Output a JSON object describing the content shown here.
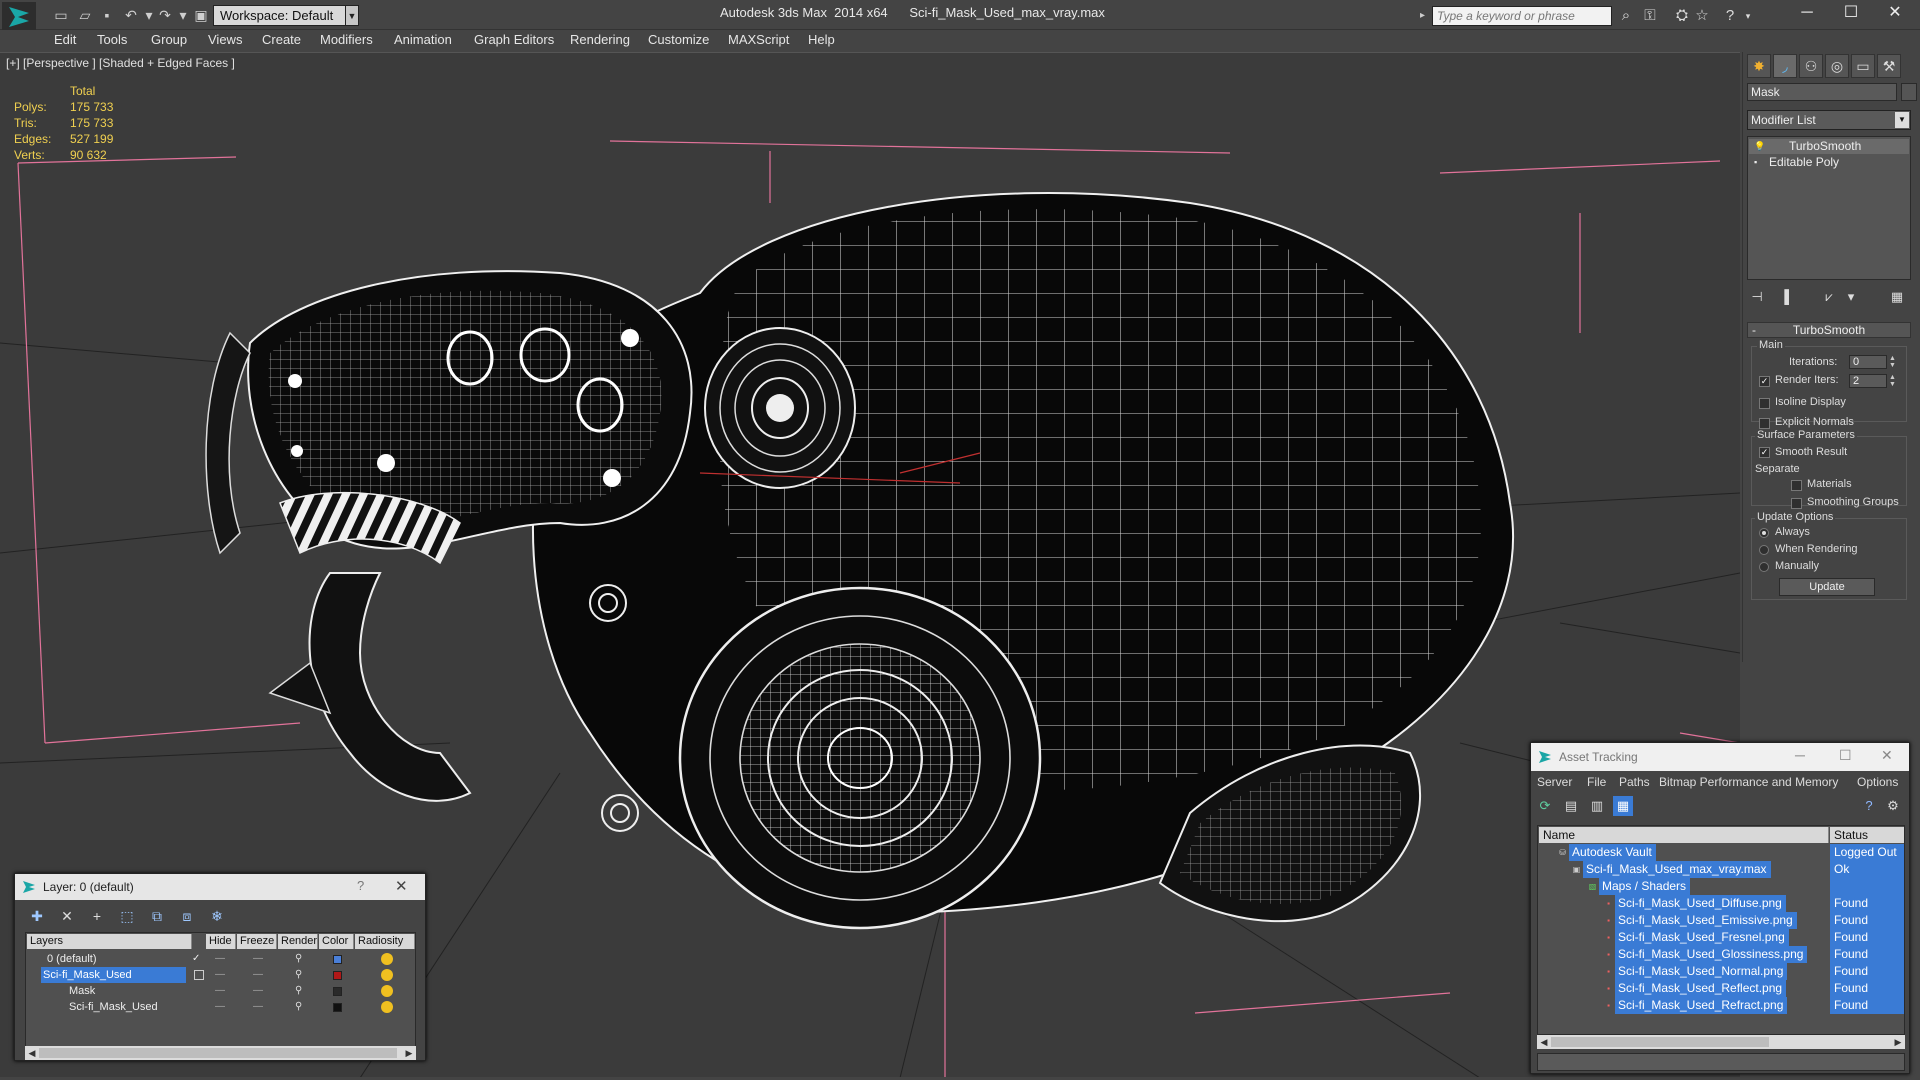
{
  "titlebar": {
    "workspace": "Workspace: Default",
    "app_title": "Autodesk 3ds Max  2014 x64",
    "file_title": "Sci-fi_Mask_Used_max_vray.max",
    "search_placeholder": "Type a keyword or phrase"
  },
  "menu": [
    "Edit",
    "Tools",
    "Group",
    "Views",
    "Create",
    "Modifiers",
    "Animation",
    "Graph Editors",
    "Rendering",
    "Customize",
    "MAXScript",
    "Help"
  ],
  "viewport": {
    "label": "[+] [Perspective ] [Shaded + Edged Faces ]",
    "stats_header": "Total",
    "stats": [
      {
        "k": "Polys:",
        "v": "175 733"
      },
      {
        "k": "Tris:",
        "v": "175 733"
      },
      {
        "k": "Edges:",
        "v": "527 199"
      },
      {
        "k": "Verts:",
        "v": "90 632"
      }
    ]
  },
  "command_panel": {
    "object_name": "Mask",
    "modifier_list": "Modifier List",
    "stack": [
      "TurboSmooth",
      "Editable Poly"
    ],
    "rollout_title": "TurboSmooth",
    "main_label": "Main",
    "iterations_label": "Iterations:",
    "iterations_value": "0",
    "render_iters_label": "Render Iters:",
    "render_iters_value": "2",
    "isoline": "Isoline Display",
    "explicit_normals": "Explicit Normals",
    "surface_params": "Surface Parameters",
    "smooth_result": "Smooth Result",
    "separate": "Separate",
    "materials": "Materials",
    "smoothing_groups": "Smoothing Groups",
    "update_options": "Update Options",
    "always": "Always",
    "when_rendering": "When Rendering",
    "manually": "Manually",
    "update_button": "Update"
  },
  "layer_dialog": {
    "title": "Layer: 0 (default)",
    "help": "?",
    "columns": [
      "Layers",
      "Hide",
      "Freeze",
      "Render",
      "Color",
      "Radiosity"
    ],
    "rows": [
      {
        "name": "0 (default)",
        "color": "#4a7fd8"
      },
      {
        "name": "Sci-fi_Mask_Used",
        "color": "#b01818"
      },
      {
        "name": "Mask",
        "color": "#2a2a2a"
      },
      {
        "name": "Sci-fi_Mask_Used",
        "color": "#111111"
      }
    ]
  },
  "asset_dialog": {
    "title": "Asset Tracking",
    "menu": [
      "Server",
      "File",
      "Paths",
      "Bitmap Performance and Memory",
      "Options"
    ],
    "columns": [
      "Name",
      "Status"
    ],
    "rows": [
      {
        "name": "Autodesk Vault",
        "status": "Logged Out"
      },
      {
        "name": "Sci-fi_Mask_Used_max_vray.max",
        "status": "Ok"
      },
      {
        "name": "Maps / Shaders",
        "status": ""
      },
      {
        "name": "Sci-fi_Mask_Used_Diffuse.png",
        "status": "Found"
      },
      {
        "name": "Sci-fi_Mask_Used_Emissive.png",
        "status": "Found"
      },
      {
        "name": "Sci-fi_Mask_Used_Fresnel.png",
        "status": "Found"
      },
      {
        "name": "Sci-fi_Mask_Used_Glossiness.png",
        "status": "Found"
      },
      {
        "name": "Sci-fi_Mask_Used_Normal.png",
        "status": "Found"
      },
      {
        "name": "Sci-fi_Mask_Used_Reflect.png",
        "status": "Found"
      },
      {
        "name": "Sci-fi_Mask_Used_Refract.png",
        "status": "Found"
      }
    ]
  }
}
